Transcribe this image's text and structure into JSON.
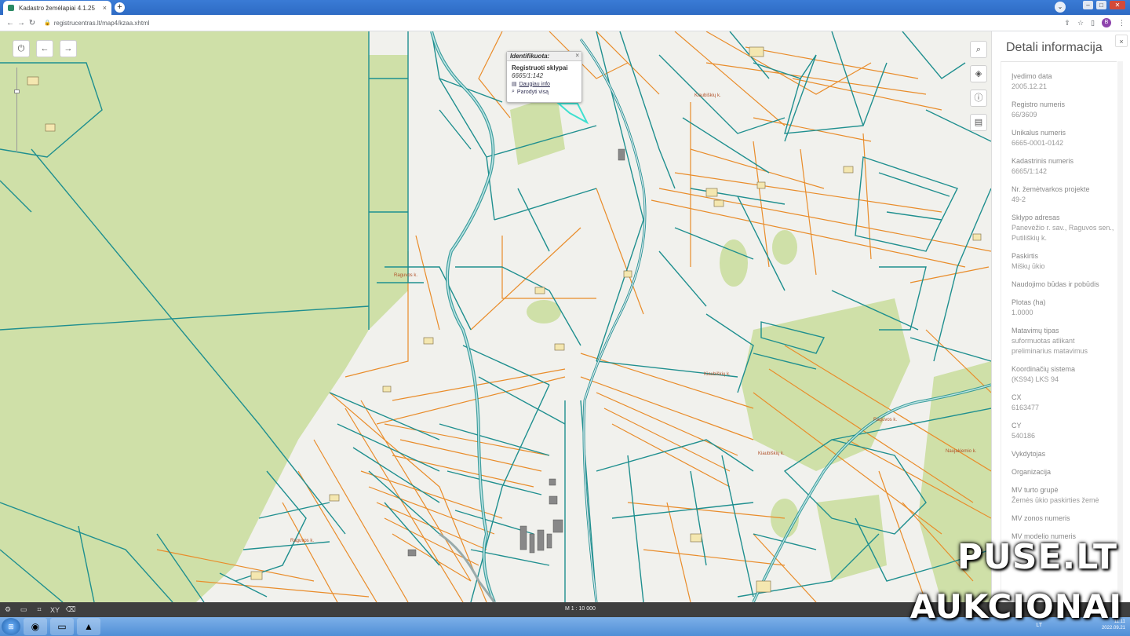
{
  "browser": {
    "tab_title": "Kadastro žemėlapiai 4.1.25",
    "tab_close": "×",
    "new_tab": "+",
    "url": "registrucentras.lt/map4/kzaa.xhtml",
    "back": "←",
    "forward": "→",
    "reload": "↻",
    "profile_initial": "B"
  },
  "map": {
    "popup": {
      "header": "Identifikuota:",
      "close": "×",
      "title": "Registruoti sklypai",
      "parcel_id": "6665/1:142",
      "links": [
        "Daugiau info",
        "Parodyti visą"
      ]
    },
    "place_labels": [
      "Kiaubiškių k.",
      "Raguvos k.",
      "Raguvos k.",
      "Kiaubiškių k.",
      "Kiaubiškių k.",
      "Naujakiemio k.",
      "Raguvos k."
    ]
  },
  "panel": {
    "title": "Detali informacija",
    "close": "×",
    "fields": [
      {
        "label": "Įvedimo data",
        "value": "2005.12.21"
      },
      {
        "label": "Registro numeris",
        "value": "66/3609"
      },
      {
        "label": "Unikalus numeris",
        "value": "6665-0001-0142"
      },
      {
        "label": "Kadastrinis numeris",
        "value": "6665/1:142"
      },
      {
        "label": "Nr. žemėtvarkos projekte",
        "value": "49-2"
      },
      {
        "label": "Sklypo adresas",
        "value": "Panevėžio r. sav., Raguvos sen., Putiliškių k."
      },
      {
        "label": "Paskirtis",
        "value": "Miškų ūkio"
      },
      {
        "label": "Naudojimo būdas ir pobūdis",
        "value": ""
      },
      {
        "label": "Plotas (ha)",
        "value": "1.0000"
      },
      {
        "label": "Matavimų tipas",
        "value": "suformuotas atlikant preliminarius matavimus"
      },
      {
        "label": "Koordinačių sistema",
        "value": "(KS94) LKS 94"
      },
      {
        "label": "CX",
        "value": "6163477"
      },
      {
        "label": "CY",
        "value": "540186"
      },
      {
        "label": "Vykdytojas",
        "value": ""
      },
      {
        "label": "Organizacija",
        "value": ""
      },
      {
        "label": "MV turto grupė",
        "value": "Žemės ūkio paskirties žemė"
      },
      {
        "label": "MV zonos numeris",
        "value": ""
      },
      {
        "label": "MV modelio numeris",
        "value": ""
      }
    ]
  },
  "statusbar": {
    "scale": "M 1 : 10 000",
    "icons": [
      "settings-icon",
      "ruler-icon",
      "select-icon",
      "coordinates-icon",
      "eraser-icon"
    ],
    "icon_glyphs": [
      "⚙",
      "▭",
      "⌗",
      "XY",
      "⌫"
    ]
  },
  "taskbar": {
    "lang": "LT",
    "time": "11:11",
    "date": "2022.09.21"
  },
  "watermark": {
    "line1": "PUSE.LT",
    "line2": "AUKCIONAI"
  },
  "colors": {
    "parcel_teal": "#1f8f8f",
    "parcel_orange": "#e98c2a",
    "forest_green": "#cfe0a8",
    "selected_parcel": "#3fe0d0",
    "map_bg": "#f1f1ed"
  }
}
